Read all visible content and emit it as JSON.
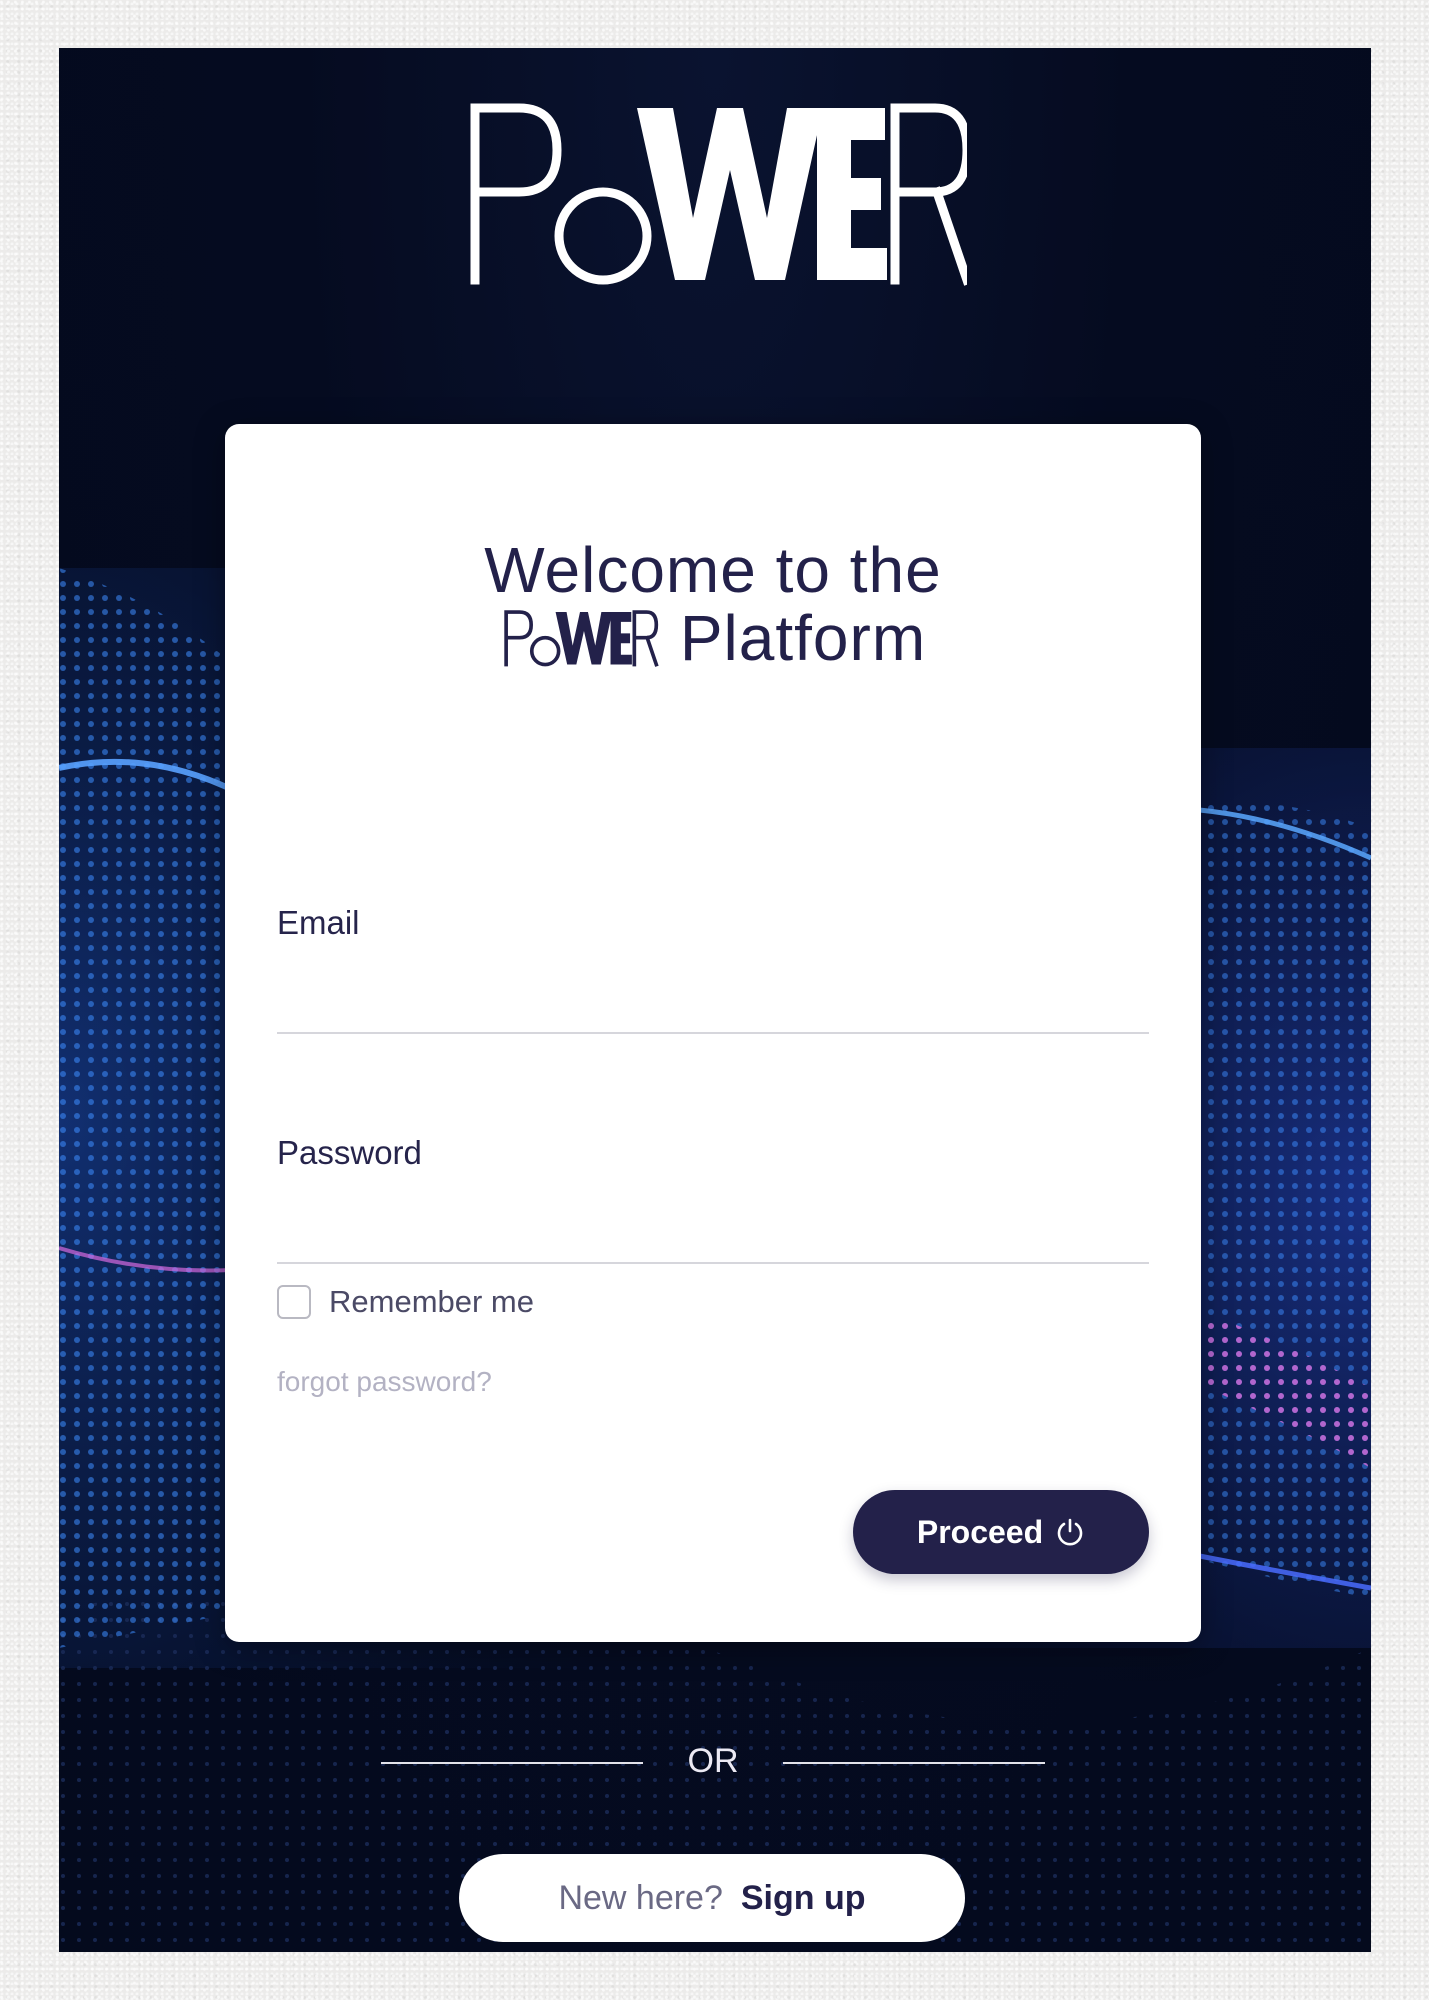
{
  "brand": {
    "logo_text": "PoWER",
    "colors": {
      "primary": "#23214a",
      "background": "#050b20",
      "accent_blue": "#2f7bff",
      "accent_pink": "#d85cd0"
    }
  },
  "login_card": {
    "welcome_line1": "Welcome to the",
    "welcome_platform": "Platform",
    "email": {
      "label": "Email",
      "value": "",
      "placeholder": ""
    },
    "password": {
      "label": "Password",
      "value": "",
      "placeholder": ""
    },
    "remember_me": {
      "label": "Remember me",
      "checked": false
    },
    "forgot_password_link": "forgot password?",
    "proceed_button": {
      "label": "Proceed",
      "icon": "power-icon"
    }
  },
  "divider": {
    "text": "OR"
  },
  "signup": {
    "question": "New here?",
    "link": "Sign up"
  }
}
